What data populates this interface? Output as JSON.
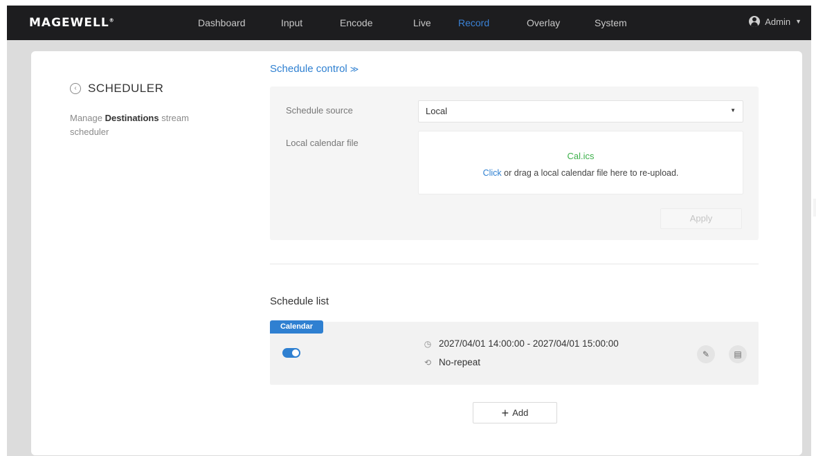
{
  "header": {
    "logo": "MAGEWELL",
    "nav": [
      "Dashboard",
      "Input",
      "Encode",
      "Live",
      "Record",
      "Overlay",
      "System"
    ],
    "active": "Record",
    "user": "Admin"
  },
  "sidebar": {
    "title": "SCHEDULER",
    "desc_prefix": "Manage ",
    "desc_bold": "Destinations",
    "desc_suffix": " stream scheduler"
  },
  "control": {
    "title": "Schedule control",
    "source_label": "Schedule source",
    "source_value": "Local",
    "file_label": "Local calendar file",
    "file_name": "Cal.ics",
    "hint_link": "Click",
    "hint_text": " or drag a local calendar file here to re-upload.",
    "apply": "Apply"
  },
  "list": {
    "title": "Schedule list",
    "items": [
      {
        "badge": "Calendar",
        "enabled": true,
        "time": "2027/04/01 14:00:00 - 2027/04/01 15:00:00",
        "repeat": "No-repeat"
      }
    ],
    "add": "Add"
  },
  "icons": {
    "back": "back-circle-icon",
    "expand": "double-chevron-down-icon",
    "time": "clock-icon",
    "repeat": "repeat-icon",
    "edit": "edit-icon",
    "delete": "delete-icon",
    "user": "user-icon"
  },
  "colors": {
    "accent": "#2f80d1",
    "file": "#3cb04a",
    "header_bg": "#1d1d1f"
  }
}
